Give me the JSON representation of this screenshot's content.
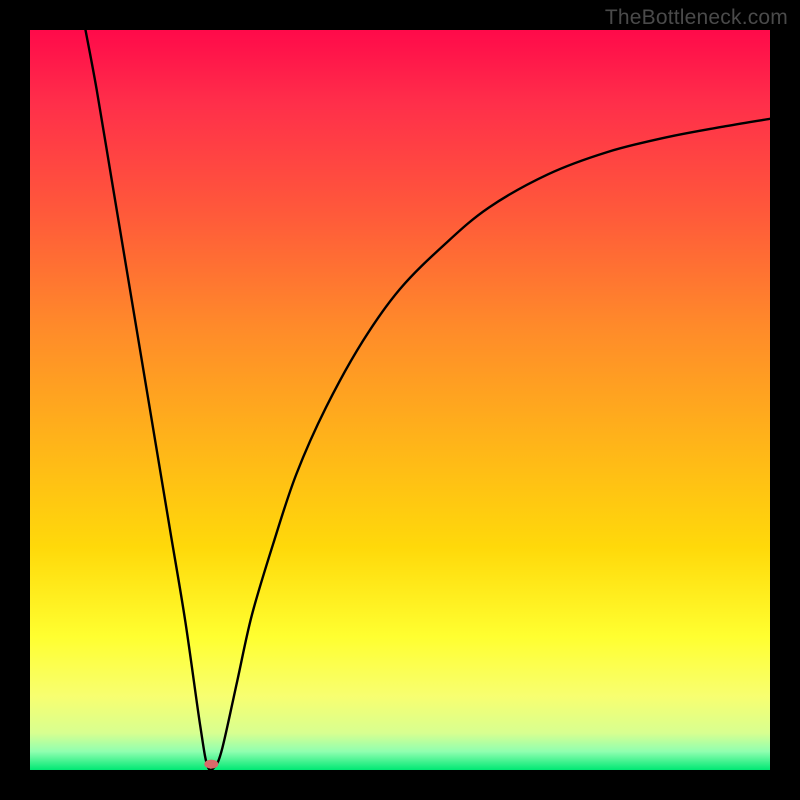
{
  "watermark": "TheBottleneck.com",
  "chart_data": {
    "type": "line",
    "title": "",
    "xlabel": "",
    "ylabel": "",
    "xlim": [
      0,
      100
    ],
    "ylim": [
      0,
      100
    ],
    "background": {
      "gradient_stops": [
        {
          "offset": 0.0,
          "color": "#ff0a4a"
        },
        {
          "offset": 0.1,
          "color": "#ff2f4a"
        },
        {
          "offset": 0.25,
          "color": "#ff5a3a"
        },
        {
          "offset": 0.4,
          "color": "#ff8a2a"
        },
        {
          "offset": 0.55,
          "color": "#ffb21a"
        },
        {
          "offset": 0.7,
          "color": "#ffd90a"
        },
        {
          "offset": 0.82,
          "color": "#ffff30"
        },
        {
          "offset": 0.9,
          "color": "#f8ff70"
        },
        {
          "offset": 0.95,
          "color": "#d8ff90"
        },
        {
          "offset": 0.975,
          "color": "#90ffb0"
        },
        {
          "offset": 1.0,
          "color": "#00e874"
        }
      ]
    },
    "curve": {
      "description": "V-shaped bottleneck curve with steep left side and asymptotic right side; minimum near x≈24, y≈0",
      "points": [
        {
          "x": 7.5,
          "y": 100
        },
        {
          "x": 9,
          "y": 92
        },
        {
          "x": 11,
          "y": 80
        },
        {
          "x": 13,
          "y": 68
        },
        {
          "x": 15,
          "y": 56
        },
        {
          "x": 17,
          "y": 44
        },
        {
          "x": 19,
          "y": 32
        },
        {
          "x": 21,
          "y": 20
        },
        {
          "x": 23,
          "y": 6
        },
        {
          "x": 24,
          "y": 0.5
        },
        {
          "x": 25,
          "y": 0.5
        },
        {
          "x": 26,
          "y": 3
        },
        {
          "x": 28,
          "y": 12
        },
        {
          "x": 30,
          "y": 21
        },
        {
          "x": 33,
          "y": 31
        },
        {
          "x": 36,
          "y": 40
        },
        {
          "x": 40,
          "y": 49
        },
        {
          "x": 45,
          "y": 58
        },
        {
          "x": 50,
          "y": 65
        },
        {
          "x": 56,
          "y": 71
        },
        {
          "x": 62,
          "y": 76
        },
        {
          "x": 70,
          "y": 80.5
        },
        {
          "x": 78,
          "y": 83.5
        },
        {
          "x": 86,
          "y": 85.5
        },
        {
          "x": 94,
          "y": 87
        },
        {
          "x": 100,
          "y": 88
        }
      ]
    },
    "marker": {
      "x": 24.5,
      "y": 0.8,
      "color": "#d86a6a"
    }
  }
}
